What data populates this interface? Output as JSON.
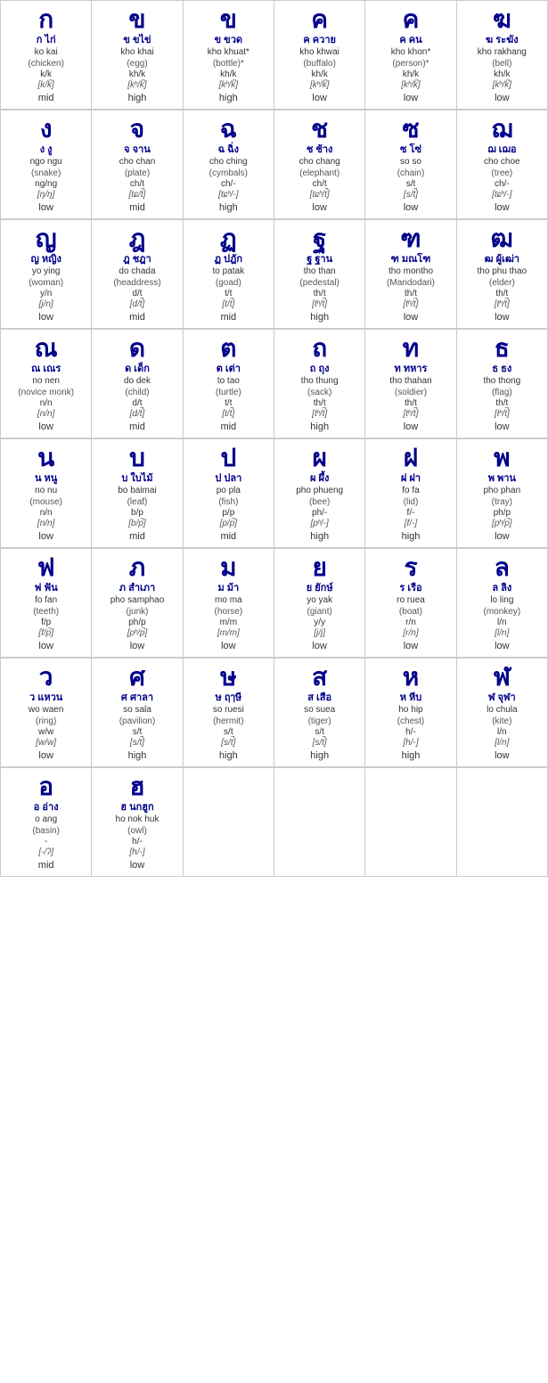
{
  "consonants": [
    {
      "rows": [
        [
          {
            "thai": "ก",
            "thaiName": "ก ไก่",
            "roman": "ko kai",
            "paren": "(chicken)",
            "phoneme": "k/k",
            "ipa": "[k/k̚]",
            "tone": "mid"
          },
          {
            "thai": "ข",
            "thaiName": "ข ขไข่",
            "roman": "kho khai",
            "paren": "(egg)",
            "phoneme": "kh/k",
            "ipa": "[kʰ/k̚]",
            "tone": "high"
          },
          {
            "thai": "ข",
            "thaiName": "ข ขวด",
            "roman": "kho khuat",
            "paren": "(bottle)*",
            "phoneme": "kh/k",
            "ipa": "[kʰ/k̚]",
            "tone": "high",
            "asterisk": true
          },
          {
            "thai": "ค",
            "thaiName": "ค ควาย",
            "roman": "kho khwai",
            "paren": "(buffalo)",
            "phoneme": "kh/k",
            "ipa": "[kʰ/k̚]",
            "tone": "low"
          },
          {
            "thai": "ค",
            "thaiName": "ค คน",
            "roman": "kho khon",
            "paren": "(person)*",
            "phoneme": "kh/k",
            "ipa": "[kʰ/k̚]",
            "tone": "low",
            "asterisk": true
          },
          {
            "thai": "ฆ",
            "thaiName": "ฆ ระฆัง",
            "roman": "kho rakhang",
            "paren": "(bell)",
            "phoneme": "kh/k",
            "ipa": "[kʰ/k̚]",
            "tone": "low"
          }
        ],
        [
          {
            "thai": "ง",
            "thaiName": "ง งู",
            "roman": "ngo ngu",
            "paren": "(snake)",
            "phoneme": "ng/ng",
            "ipa": "[ŋ/ŋ]",
            "tone": "low"
          },
          {
            "thai": "จ",
            "thaiName": "จ จาน",
            "roman": "cho chan",
            "paren": "(plate)",
            "phoneme": "ch/t",
            "ipa": "[tɕ/t̚]",
            "tone": "mid"
          },
          {
            "thai": "ฉ",
            "thaiName": "ฉ ฉิ่ง",
            "roman": "cho ching",
            "paren": "(cymbals)",
            "phoneme": "ch/-",
            "ipa": "[tɕʰ/-]",
            "tone": "high"
          },
          {
            "thai": "ช",
            "thaiName": "ช ช้าง",
            "roman": "cho chang",
            "paren": "(elephant)",
            "phoneme": "ch/t",
            "ipa": "[tɕʰ/t̚]",
            "tone": "low"
          },
          {
            "thai": "ซ",
            "thaiName": "ซ โซ่",
            "roman": "so so",
            "paren": "(chain)",
            "phoneme": "s/t",
            "ipa": "[s/t̚]",
            "tone": "low"
          },
          {
            "thai": "ฌ",
            "thaiName": "ฌ เฌอ",
            "roman": "cho choe",
            "paren": "(tree)",
            "phoneme": "ch/-",
            "ipa": "[tɕʰ/-]",
            "tone": "low"
          }
        ],
        [
          {
            "thai": "ญ",
            "thaiName": "ญ หญิง",
            "roman": "yo ying",
            "paren": "(woman)",
            "phoneme": "y/n",
            "ipa": "[j/n]",
            "tone": "low"
          },
          {
            "thai": "ฎ",
            "thaiName": "ฎ ชฎา",
            "roman": "do chada",
            "paren": "(headdress)",
            "phoneme": "d/t",
            "ipa": "[d/t̚]",
            "tone": "mid"
          },
          {
            "thai": "ฏ",
            "thaiName": "ฏ ปฎัก",
            "roman": "to patak",
            "paren": "(goad)",
            "phoneme": "t/t",
            "ipa": "[t/t̚]",
            "tone": "mid"
          },
          {
            "thai": "ฐ",
            "thaiName": "ฐ ฐาน",
            "roman": "tho than",
            "paren": "(pedestal)",
            "phoneme": "th/t",
            "ipa": "[tʰ/t̚]",
            "tone": "high"
          },
          {
            "thai": "ฑ",
            "thaiName": "ฑ มณโฑ",
            "roman": "tho montho",
            "paren": "(Mandodari)",
            "phoneme": "th/t",
            "ipa": "[tʰ/t̚]",
            "tone": "low"
          },
          {
            "thai": "ฒ",
            "thaiName": "ฒ ผู้เฒ่า",
            "roman": "tho phu thao",
            "paren": "(elder)",
            "phoneme": "th/t",
            "ipa": "[tʰ/t̚]",
            "tone": "low"
          }
        ],
        [
          {
            "thai": "ณ",
            "thaiName": "ณ เณร",
            "roman": "no nen",
            "paren": "(novice monk)",
            "phoneme": "n/n",
            "ipa": "[n/n]",
            "tone": "low"
          },
          {
            "thai": "ด",
            "thaiName": "ด เด็ก",
            "roman": "do dek",
            "paren": "(child)",
            "phoneme": "d/t",
            "ipa": "[d/t̚]",
            "tone": "mid"
          },
          {
            "thai": "ต",
            "thaiName": "ต เต่า",
            "roman": "to tao",
            "paren": "(turtle)",
            "phoneme": "t/t",
            "ipa": "[t/t̚]",
            "tone": "mid"
          },
          {
            "thai": "ถ",
            "thaiName": "ถ ถุง",
            "roman": "tho thung",
            "paren": "(sack)",
            "phoneme": "th/t",
            "ipa": "[tʰ/t̚]",
            "tone": "high"
          },
          {
            "thai": "ท",
            "thaiName": "ท ทหาร",
            "roman": "tho thahan",
            "paren": "(soldier)",
            "phoneme": "th/t",
            "ipa": "[tʰ/t̚]",
            "tone": "low"
          },
          {
            "thai": "ธ",
            "thaiName": "ธ ธง",
            "roman": "tho thong",
            "paren": "(flag)",
            "phoneme": "th/t",
            "ipa": "[tʰ/t̚]",
            "tone": "low"
          }
        ],
        [
          {
            "thai": "น",
            "thaiName": "น หนู",
            "roman": "no nu",
            "paren": "(mouse)",
            "phoneme": "n/n",
            "ipa": "[n/n]",
            "tone": "low"
          },
          {
            "thai": "บ",
            "thaiName": "บ ใบไม้",
            "roman": "bo baimai",
            "paren": "(leaf)",
            "phoneme": "b/p",
            "ipa": "[b/p̚]",
            "tone": "mid"
          },
          {
            "thai": "ป",
            "thaiName": "ป ปลา",
            "roman": "po pla",
            "paren": "(fish)",
            "phoneme": "p/p",
            "ipa": "[p/p̚]",
            "tone": "mid"
          },
          {
            "thai": "ผ",
            "thaiName": "ผ ผึ้ง",
            "roman": "pho phueng",
            "paren": "(bee)",
            "phoneme": "ph/-",
            "ipa": "[pʰ/-]",
            "tone": "high"
          },
          {
            "thai": "ฝ",
            "thaiName": "ฝ ฝา",
            "roman": "fo fa",
            "paren": "(lid)",
            "phoneme": "f/-",
            "ipa": "[f/-]",
            "tone": "high"
          },
          {
            "thai": "พ",
            "thaiName": "พ พาน",
            "roman": "pho phan",
            "paren": "(tray)",
            "phoneme": "ph/p",
            "ipa": "[pʰ/p̚]",
            "tone": "low"
          }
        ],
        [
          {
            "thai": "ฟ",
            "thaiName": "ฟ ฟัน",
            "roman": "fo fan",
            "paren": "(teeth)",
            "phoneme": "f/p",
            "ipa": "[f/p̚]",
            "tone": "low"
          },
          {
            "thai": "ภ",
            "thaiName": "ภ สำเภา",
            "roman": "pho samphao",
            "paren": "(junk)",
            "phoneme": "ph/p",
            "ipa": "[pʰ/p̚]",
            "tone": "low"
          },
          {
            "thai": "ม",
            "thaiName": "ม ม้า",
            "roman": "mo ma",
            "paren": "(horse)",
            "phoneme": "m/m",
            "ipa": "[m/m]",
            "tone": "low"
          },
          {
            "thai": "ย",
            "thaiName": "ย ยักษ์",
            "roman": "yo yak",
            "paren": "(giant)",
            "phoneme": "y/y",
            "ipa": "[j/j]",
            "tone": "low"
          },
          {
            "thai": "ร",
            "thaiName": "ร เรือ",
            "roman": "ro ruea",
            "paren": "(boat)",
            "phoneme": "r/n",
            "ipa": "[r/n]",
            "tone": "low"
          },
          {
            "thai": "ล",
            "thaiName": "ล ลิง",
            "roman": "lo ling",
            "paren": "(monkey)",
            "phoneme": "l/n",
            "ipa": "[l/n]",
            "tone": "low"
          }
        ],
        [
          {
            "thai": "ว",
            "thaiName": "ว แหวน",
            "roman": "wo waen",
            "paren": "(ring)",
            "phoneme": "w/w",
            "ipa": "[w/w]",
            "tone": "low"
          },
          {
            "thai": "ศ",
            "thaiName": "ศ ศาลา",
            "roman": "so sala",
            "paren": "(pavilion)",
            "phoneme": "s/t",
            "ipa": "[s/t̚]",
            "tone": "high"
          },
          {
            "thai": "ษ",
            "thaiName": "ษ ฤๅษี",
            "roman": "so ruesi",
            "paren": "(hermit)",
            "phoneme": "s/t",
            "ipa": "[s/t̚]",
            "tone": "high"
          },
          {
            "thai": "ส",
            "thaiName": "ส เสือ",
            "roman": "so suea",
            "paren": "(tiger)",
            "phoneme": "s/t",
            "ipa": "[s/t̚]",
            "tone": "high"
          },
          {
            "thai": "ห",
            "thaiName": "ห หีบ",
            "roman": "ho hip",
            "paren": "(chest)",
            "phoneme": "h/-",
            "ipa": "[h/-]",
            "tone": "high"
          },
          {
            "thai": "ฬ",
            "thaiName": "ฬ จุฬา",
            "roman": "lo chula",
            "paren": "(kite)",
            "phoneme": "l/n",
            "ipa": "[l/n]",
            "tone": "low"
          }
        ]
      ]
    }
  ],
  "lastRow": [
    {
      "thai": "อ",
      "thaiName": "อ อ่าง",
      "roman": "o ang",
      "paren": "(basin)",
      "phoneme": "-",
      "ipa": "[-/ʔ]",
      "tone": "mid"
    },
    {
      "thai": "ฮ",
      "thaiName": "ฮ นกฮูก",
      "roman": "ho nok huk",
      "paren": "(owl)",
      "phoneme": "h/-",
      "ipa": "[h/-]",
      "tone": "low"
    }
  ]
}
